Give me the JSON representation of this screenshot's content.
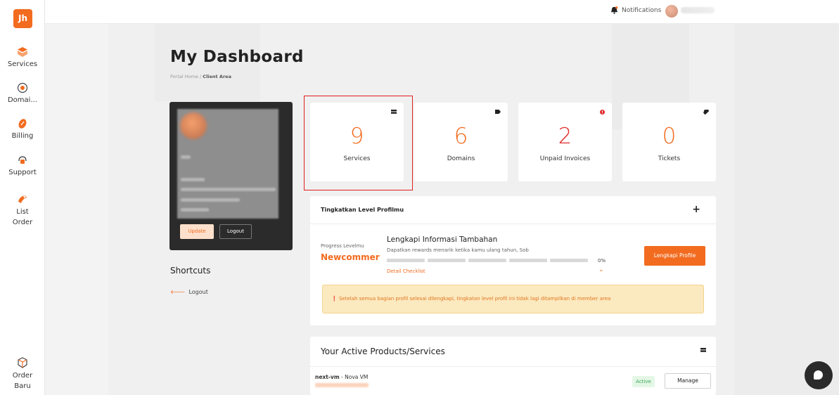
{
  "brand": {
    "logo_text": "Jh",
    "accent": "#f26b1f"
  },
  "sidebar": {
    "items": [
      {
        "label": "Services",
        "icon": "box-icon"
      },
      {
        "label": "Domai...",
        "icon": "globe-icon"
      },
      {
        "label": "Billing",
        "icon": "billing-icon"
      },
      {
        "label": "Support",
        "icon": "support-icon"
      },
      {
        "label": "List Order",
        "icon": "list-order-icon"
      }
    ],
    "bottom_item": {
      "label": "Order Baru",
      "icon": "cube-icon"
    }
  },
  "topbar": {
    "notifications_label": "Notifications"
  },
  "page": {
    "title": "My Dashboard",
    "breadcrumb": {
      "home": "Portal Home",
      "separator": "/",
      "current": "Client Area"
    }
  },
  "profile": {
    "update_label": "Update",
    "logout_label": "Logout"
  },
  "shortcuts": {
    "title": "Shortcuts",
    "logout_label": "Logout"
  },
  "stats": [
    {
      "value": "9",
      "label": "Services",
      "color": "#f26b1f",
      "icon": "server-icon"
    },
    {
      "value": "6",
      "label": "Domains",
      "color": "#f26b1f",
      "icon": "tag-icon"
    },
    {
      "value": "2",
      "label": "Unpaid Invoices",
      "color": "#e02b2b",
      "icon": "alert-icon"
    },
    {
      "value": "0",
      "label": "Tickets",
      "color": "#f26b1f",
      "icon": "ticket-icon"
    }
  ],
  "level": {
    "title": "Tingkatkan Level Profilmu",
    "progress_label": "Progress Levelmu",
    "progress_value": "Newcommer",
    "info_title": "Lengkapi Informasi Tambahan",
    "info_subtitle": "Dapatkan rewards menarik ketika kamu ulang tahun, Sob",
    "percent": "0%",
    "detail_link": "Detail Checklist",
    "button_label": "Lengkapi Profile",
    "alert_text": "Setelah semua bagian profil selesai dilengkapi, tingkatan level profil ini tidak lagi ditampilkan di member area"
  },
  "products": {
    "title": "Your Active Products/Services",
    "items": [
      {
        "host": "next-vm",
        "separator": " - ",
        "plan": "Nova VM",
        "status": "Active",
        "action": "Manage"
      }
    ]
  }
}
